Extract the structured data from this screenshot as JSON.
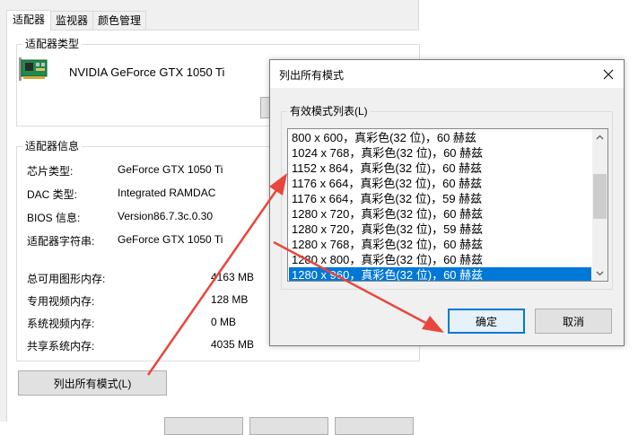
{
  "tabs": [
    {
      "label": "适配器",
      "active": true
    },
    {
      "label": "监视器",
      "active": false
    },
    {
      "label": "颜色管理",
      "active": false
    }
  ],
  "adapter_type": {
    "title": "适配器类型",
    "name": "NVIDIA GeForce GTX 1050 Ti",
    "icon": "graphics-card-icon"
  },
  "adapter_info": {
    "title": "适配器信息",
    "rows": [
      {
        "label": "芯片类型:",
        "value": "GeForce GTX 1050 Ti"
      },
      {
        "label": "DAC 类型:",
        "value": "Integrated RAMDAC"
      },
      {
        "label": "BIOS 信息:",
        "value": "Version86.7.3c.0.30"
      },
      {
        "label": "适配器字符串:",
        "value": "GeForce GTX 1050 Ti"
      }
    ]
  },
  "memory": [
    {
      "label": "总可用图形内存:",
      "value": "4163 MB"
    },
    {
      "label": "专用视频内存:",
      "value": "128 MB"
    },
    {
      "label": "系统视频内存:",
      "value": "0 MB"
    },
    {
      "label": "共享系统内存:",
      "value": "4035 MB"
    }
  ],
  "list_modes_button": "列出所有模式(L)",
  "dialog": {
    "title": "列出所有模式",
    "group_title": "有效模式列表(L)",
    "modes": [
      "800 x 600，真彩色(32 位)，60 赫兹",
      "1024 x 768，真彩色(32 位)，60 赫兹",
      "1152 x 864，真彩色(32 位)，60 赫兹",
      "1176 x 664，真彩色(32 位)，60 赫兹",
      "1176 x 664，真彩色(32 位)，59 赫兹",
      "1280 x 720，真彩色(32 位)，60 赫兹",
      "1280 x 720，真彩色(32 位)，59 赫兹",
      "1280 x 768，真彩色(32 位)，60 赫兹",
      "1280 x 800，真彩色(32 位)，60 赫兹",
      "1280 x 960，真彩色(32 位)，60 赫兹"
    ],
    "selected_index": 9,
    "ok_label": "确定",
    "cancel_label": "取消"
  },
  "colors": {
    "selection": "#0078d7",
    "annotation_arrow": "#e8463c",
    "window_bg": "#f0f0f0"
  }
}
